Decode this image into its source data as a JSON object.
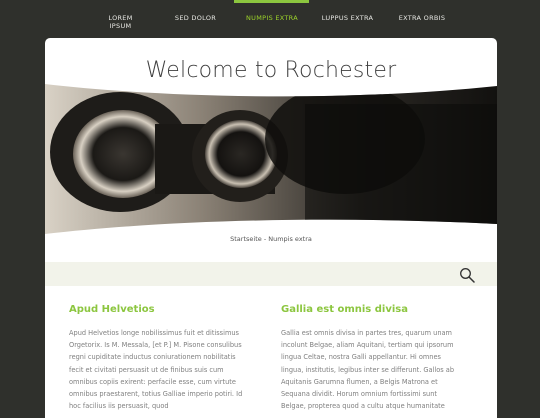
{
  "nav": {
    "items": [
      {
        "label": "LOREM IPSUM"
      },
      {
        "label": "SED DOLOR"
      },
      {
        "label": "NUMPIS EXTRA"
      },
      {
        "label": "LUPPUS EXTRA"
      },
      {
        "label": "EXTRA ORBIS"
      }
    ],
    "active_index": 2,
    "active_color": "#8cc63f"
  },
  "header": {
    "title": "Welcome to Rochester"
  },
  "hero": {
    "image_subject": "binoculars-photo"
  },
  "breadcrumb": {
    "home": "Startseite",
    "separator": " - ",
    "current": "Numpis extra"
  },
  "search": {
    "icon": "search-icon"
  },
  "content": {
    "left": {
      "heading": "Apud Helvetios",
      "text": "Apud Helvetios longe nobilissimus fuit et ditissimus Orgetorix. Is M. Messala, [et P.] M. Pisone consulibus regni cupiditate inductus coniurationem nobilitatis fecit et civitati persuasit ut de finibus suis cum omnibus copiis exirent: perfacile esse, cum virtute omnibus praestarent, totius Galliae imperio potiri. Id hoc facilius iis persuasit, quod"
    },
    "right": {
      "heading": "Gallia est omnis divisa",
      "text": "Gallia est omnis divisa in partes tres, quarum unam incolunt Belgae, aliam Aquitani, tertiam qui ipsorum lingua Celtae, nostra Galli appellantur. Hi omnes lingua, institutis, legibus inter se differunt. Gallos ab Aquitanis Garumna flumen, a Belgis Matrona et Sequana dividit. Horum omnium fortissimi sunt Belgae, propterea quod a cultu atque humanitate"
    }
  },
  "colors": {
    "background": "#2f302c",
    "accent": "#8cc63f",
    "card": "#ffffff",
    "search_band": "#f2f3ea"
  }
}
